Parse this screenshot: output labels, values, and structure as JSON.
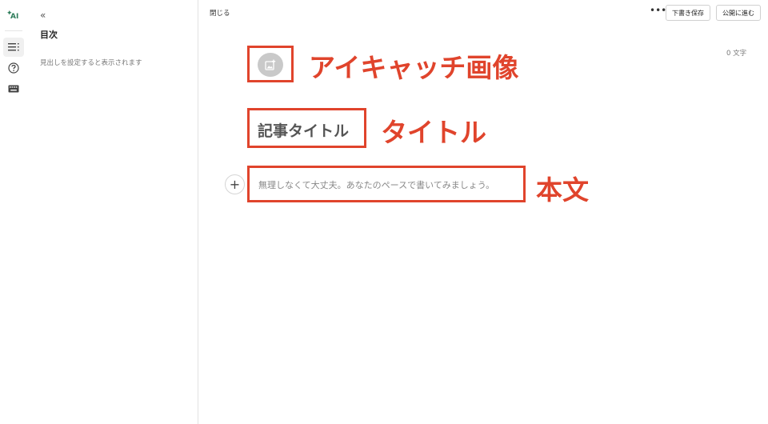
{
  "rail": {
    "ai_label": "AI",
    "ai_spark": "✦",
    "icons": [
      "list-icon",
      "help-icon",
      "keyboard-icon"
    ]
  },
  "sidebar": {
    "collapse_glyph": "«",
    "title": "目次",
    "hint": "見出しを設定すると表示されます"
  },
  "topbar": {
    "close_label": "閉じる",
    "more_glyph": "•••",
    "draft_label": "下書き保存",
    "publish_label": "公開に進む"
  },
  "editor": {
    "char_count": "0 文字",
    "title_placeholder": "記事タイトル",
    "body_placeholder": "無理しなくて大丈夫。あなたのペースで書いてみましょう。",
    "add_glyph": "+"
  },
  "annotations": {
    "eyecatch": "アイキャッチ画像",
    "title": "タイトル",
    "body": "本文",
    "color": "#e0442c"
  }
}
